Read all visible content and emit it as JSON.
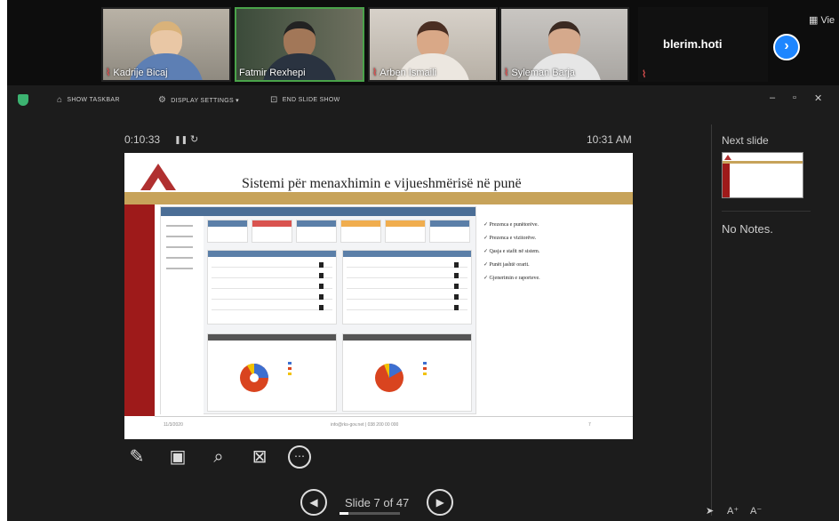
{
  "participants": [
    {
      "name": "Kadrije Bicaj",
      "mic_muted": true
    },
    {
      "name": "Fatmir Rexhepi",
      "mic_muted": false
    },
    {
      "name": "Arben Ismaili",
      "mic_muted": true
    },
    {
      "name": "Syleman Barja",
      "mic_muted": true
    }
  ],
  "self_user": {
    "name": "blerim.hoti",
    "mic_muted": true
  },
  "view_label": "Vie",
  "toolbar": {
    "show_taskbar": "SHOW TASKBAR",
    "display_settings": "DISPLAY SETTINGS ▾",
    "end_slide_show": "END SLIDE SHOW"
  },
  "presenter": {
    "timer": "0:10:33",
    "clock": "10:31 AM",
    "slide_counter": "Slide 7 of 47",
    "progress": 0.149
  },
  "slide": {
    "title": "Sistemi për menaxhimin e vijueshmërisë në punë",
    "bullets": [
      "Prezenca e punëtorëve.",
      "Prezenca e vizitorëve.",
      "Qasja e stafit në sistem.",
      "Punët jashtë orarit.",
      "Gjenerimin e raporteve."
    ],
    "footer_left": "11/3/2020",
    "footer_center": "info@rks-gov.net | 038 200 00 000",
    "footer_right": "7"
  },
  "right_panel": {
    "next_slide_label": "Next slide",
    "notes": "No Notes."
  },
  "colors": {
    "accent_blue": "#1e86ff",
    "slide_red": "#9e1a1a",
    "slide_gold": "#c7a35a"
  }
}
